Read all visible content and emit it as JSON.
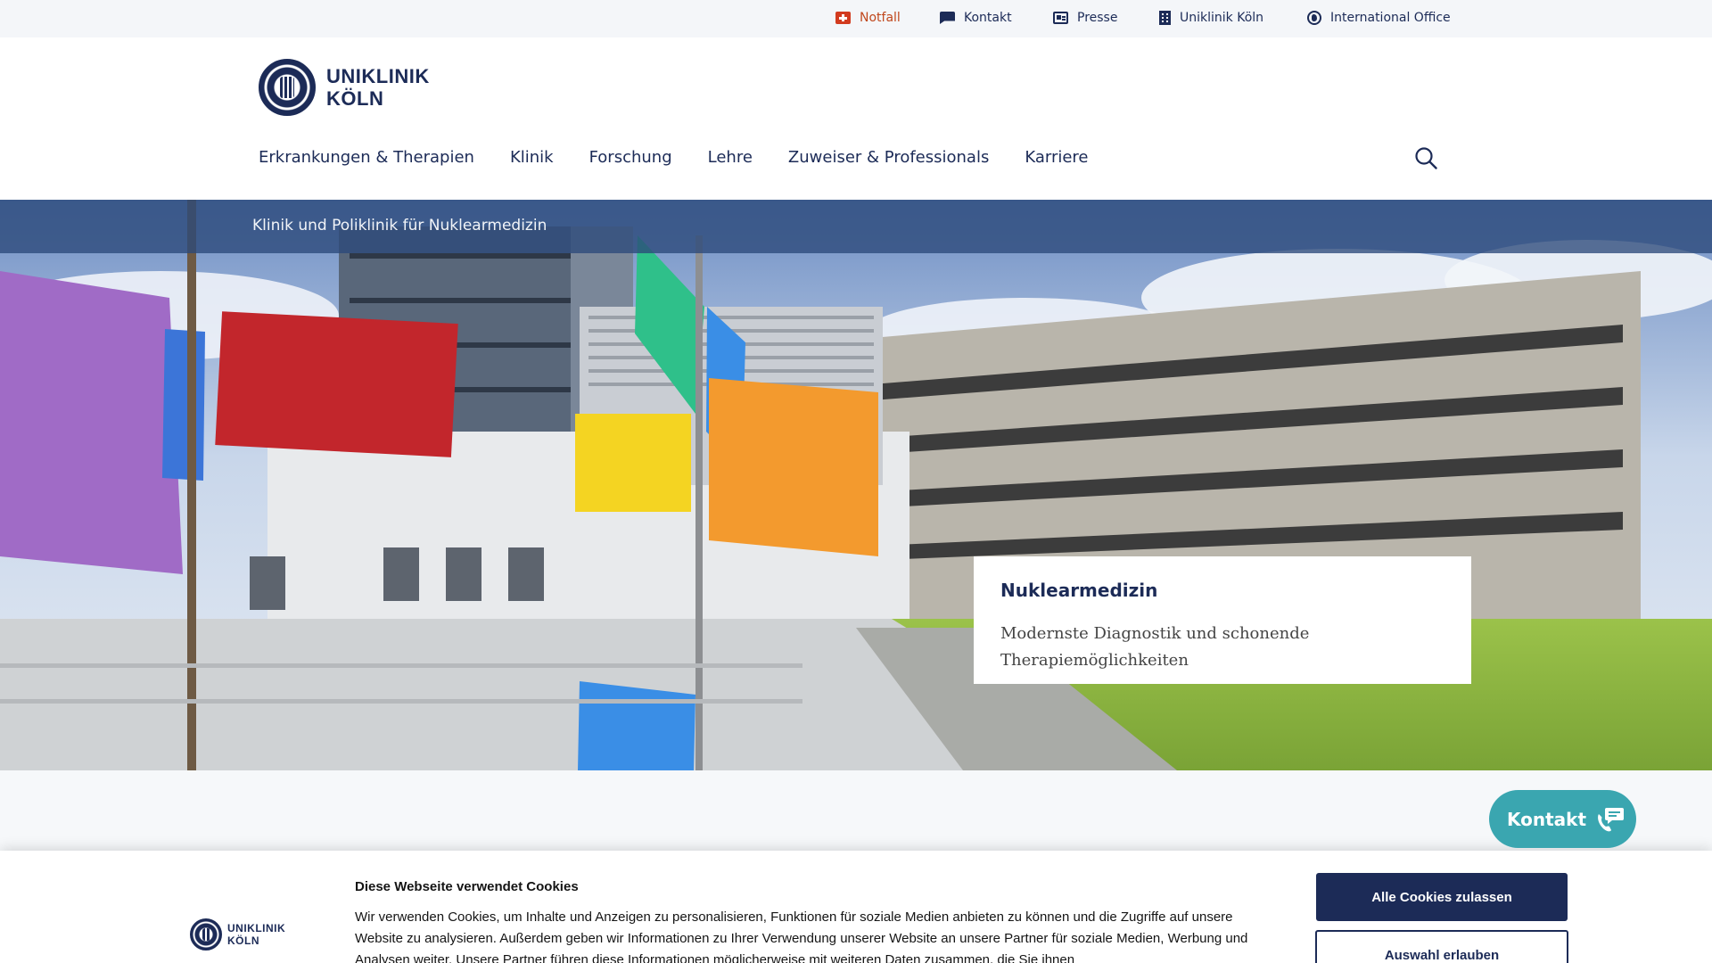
{
  "utility_nav": {
    "notfall": "Notfall",
    "kontakt": "Kontakt",
    "presse": "Presse",
    "uniklinik": "Uniklinik Köln",
    "international": "International Office"
  },
  "logo": {
    "line1": "UNIKLINIK",
    "line2": "KÖLN"
  },
  "main_nav": {
    "items": [
      "Erkrankungen & Therapien",
      "Klinik",
      "Forschung",
      "Lehre",
      "Zuweiser & Professionals",
      "Karriere"
    ]
  },
  "breadcrumb": {
    "current": "Klinik und Poliklinik für Nuklearmedizin"
  },
  "hero": {
    "title": "Nuklearmedizin",
    "subtitle_line1": "Modernste Diagnostik und schonende",
    "subtitle_line2": "Therapiemöglichkeiten"
  },
  "contact_fab": {
    "label": "Kontakt"
  },
  "cookie_banner": {
    "title": "Diese Webseite verwendet Cookies",
    "text": "Wir verwenden Cookies, um Inhalte und Anzeigen zu personalisieren, Funktionen für soziale Medien anbieten zu können und die Zugriffe auf unsere Website zu analysieren. Außerdem geben wir Informationen zu Ihrer Verwendung unserer Website an unsere Partner für soziale Medien, Werbung und Analysen weiter. Unsere Partner führen diese Informationen möglicherweise mit weiteren Daten zusammen, die Sie ihnen",
    "accept_all": "Alle Cookies zulassen",
    "allow_selection": "Auswahl erlauben"
  },
  "colors": {
    "brand_navy": "#1c2b57",
    "notfall_red": "#c0471c",
    "contact_teal": "#3aa6b0"
  }
}
